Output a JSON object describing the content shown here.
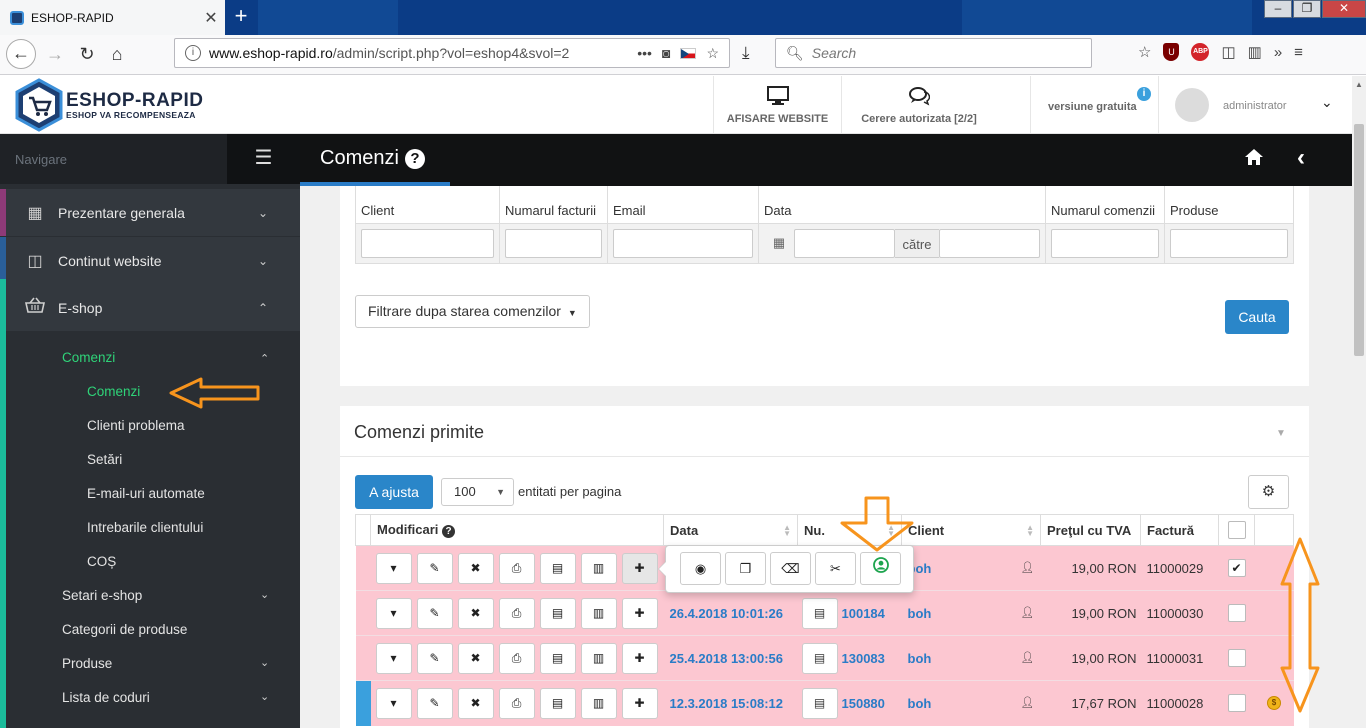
{
  "browser": {
    "tab_title": "ESHOP-RAPID",
    "tab_close": "✕",
    "new_tab": "+",
    "url_host": "www.eshop-rapid.ro",
    "url_path": "/admin/script.php?vol=eshop4&svol=2",
    "url_more": "•••",
    "search_placeholder": "Search",
    "ext_abp": "ABP",
    "ext_ublock": "U"
  },
  "header": {
    "logo_title": "ESHOP-RAPID",
    "logo_subtitle": "ESHOP VA RECOMPENSEAZA",
    "afisare_label": "AFISARE WEBSITE",
    "cerere_label": "Cerere autorizata [2/2]",
    "versiune_label": "versiune gratuita",
    "user_name": "administrator"
  },
  "sidebar": {
    "nav_label": "Navigare",
    "items": [
      {
        "label": "Prezentare generala"
      },
      {
        "label": "Continut website"
      },
      {
        "label": "E-shop"
      }
    ],
    "sub_comenzi": "Comenzi",
    "sub_items": [
      {
        "label": "Comenzi"
      },
      {
        "label": "Clienti problema"
      },
      {
        "label": "Setări"
      },
      {
        "label": "E-mail-uri automate"
      },
      {
        "label": "Intrebarile clientului"
      },
      {
        "label": "COȘ"
      }
    ],
    "more_items": [
      {
        "label": "Setari e-shop"
      },
      {
        "label": "Categorii de produse"
      },
      {
        "label": "Produse"
      },
      {
        "label": "Lista de coduri"
      }
    ]
  },
  "page": {
    "title": "Comenzi",
    "help": "?"
  },
  "filters": {
    "columns": [
      "Client",
      "Numarul facturii",
      "Email",
      "Data",
      "Numarul comenzii",
      "Produse"
    ],
    "date_to": "către",
    "status_filter": "Filtrare dupa starea comenzilor",
    "search_button": "Cauta"
  },
  "orders_panel": {
    "title": "Comenzi primite",
    "adjust_button": "A ajusta",
    "per_page_value": "100",
    "per_page_label": "entitati per pagina",
    "columns": {
      "modificari": "Modificari",
      "data": "Data",
      "nu": "Nu.",
      "client": "Client",
      "pret": "Preţul cu TVA",
      "factura": "Factură"
    },
    "rows": [
      {
        "date": "",
        "number": "",
        "client": "boh",
        "price": "19,00 RON",
        "invoice": "11000029",
        "checked": "✔",
        "coin": ""
      },
      {
        "date": "26.4.2018 10:01:26",
        "number": "100184",
        "client": "boh",
        "price": "19,00 RON",
        "invoice": "11000030",
        "checked": "",
        "coin": ""
      },
      {
        "date": "25.4.2018 13:00:56",
        "number": "130083",
        "client": "boh",
        "price": "19,00 RON",
        "invoice": "11000031",
        "checked": "",
        "coin": ""
      },
      {
        "date": "12.3.2018 15:08:12",
        "number": "150880",
        "client": "boh",
        "price": "17,67 RON",
        "invoice": "11000028",
        "checked": "",
        "coin": "$"
      }
    ]
  },
  "colors": {
    "accent_blue": "#2a86c9",
    "sidebar_bg": "#2a2e33",
    "active_green": "#2fd479",
    "row_pink": "#fcc7d1",
    "annotation_orange": "#f7941d"
  }
}
